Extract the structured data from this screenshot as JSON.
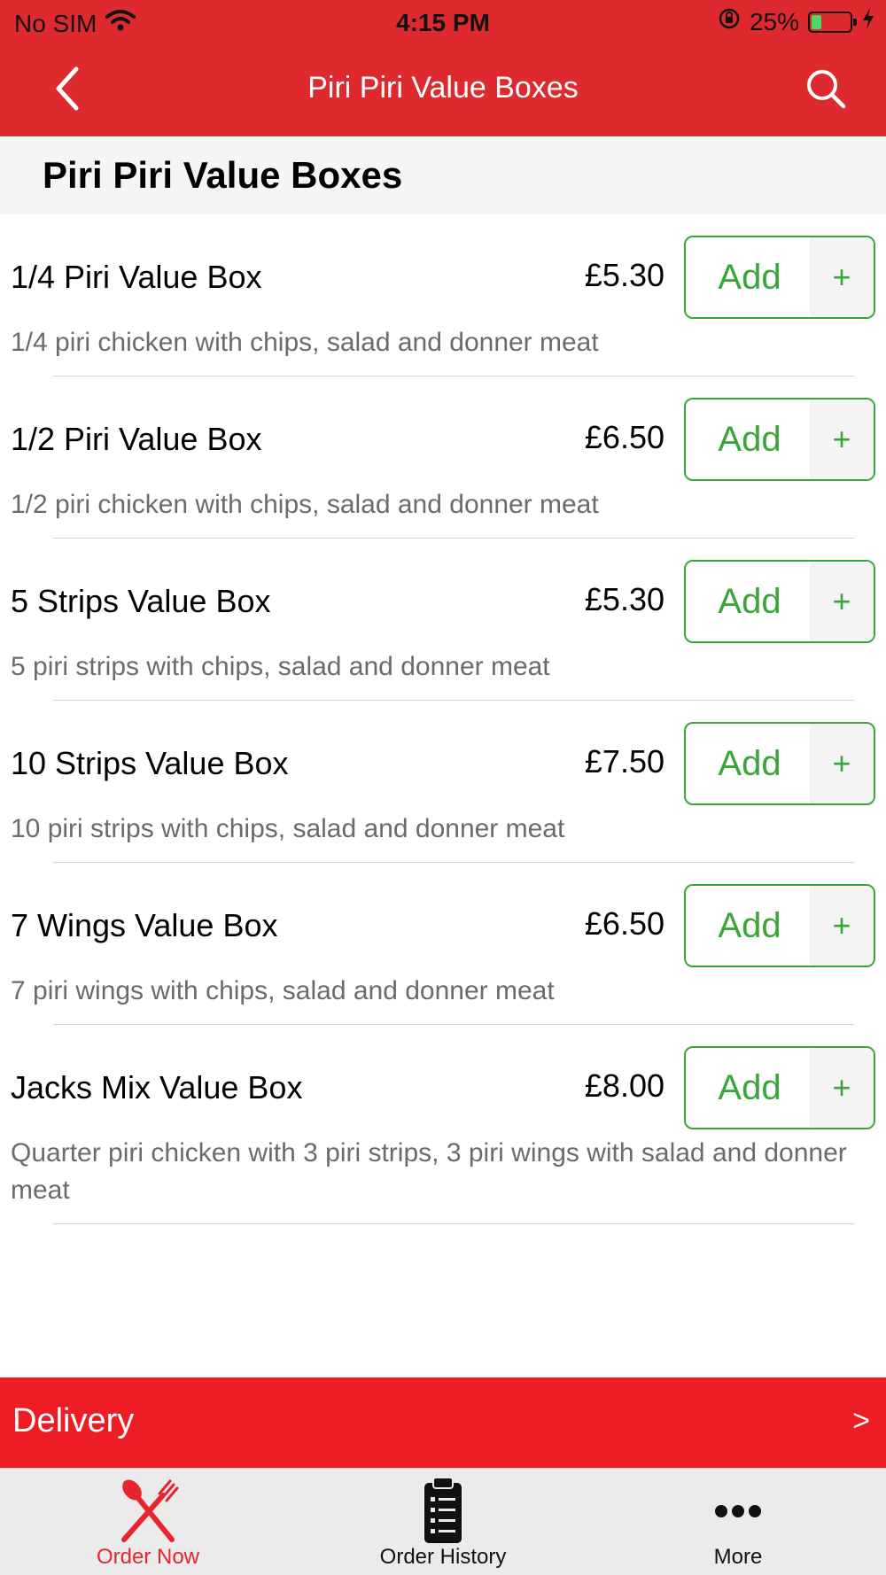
{
  "status_bar": {
    "carrier": "No SIM",
    "time": "4:15 PM",
    "battery_percent": "25%",
    "battery_level": 0.25,
    "icons": [
      "wifi-icon",
      "rotation-lock-icon",
      "battery-icon",
      "charging-bolt-icon"
    ]
  },
  "nav": {
    "title": "Piri Piri Value Boxes",
    "back_icon": "chevron-left-icon",
    "search_icon": "search-icon"
  },
  "section": {
    "title": "Piri Piri Value Boxes"
  },
  "items": [
    {
      "name": "1/4 Piri Value Box",
      "price": "£5.30",
      "description": "1/4 piri chicken with chips, salad and donner meat",
      "add_label": "Add",
      "add_plus": "+"
    },
    {
      "name": "1/2 Piri Value Box",
      "price": "£6.50",
      "description": "1/2 piri chicken with chips, salad and donner meat",
      "add_label": "Add",
      "add_plus": "+"
    },
    {
      "name": "5 Strips Value Box",
      "price": "£5.30",
      "description": "5 piri strips with chips, salad and donner meat",
      "add_label": "Add",
      "add_plus": "+"
    },
    {
      "name": "10 Strips Value Box",
      "price": "£7.50",
      "description": "10 piri strips with chips, salad and donner meat",
      "add_label": "Add",
      "add_plus": "+"
    },
    {
      "name": "7 Wings Value Box",
      "price": "£6.50",
      "description": "7 piri wings with chips, salad and donner meat",
      "add_label": "Add",
      "add_plus": "+"
    },
    {
      "name": "Jacks Mix Value Box",
      "price": "£8.00",
      "description": "Quarter piri chicken with 3 piri strips, 3 piri wings with salad and donner meat",
      "add_label": "Add",
      "add_plus": "+"
    }
  ],
  "delivery": {
    "label": "Delivery",
    "arrow": ">"
  },
  "tabs": [
    {
      "label": "Order Now",
      "icon": "fork-knife-icon",
      "active": true
    },
    {
      "label": "Order History",
      "icon": "clipboard-icon",
      "active": false
    },
    {
      "label": "More",
      "icon": "more-dots-icon",
      "active": false
    }
  ],
  "colors": {
    "brand_red": "#de2a2f",
    "delivery_red": "#ee1c25",
    "add_green": "#3aa63a",
    "tab_active": "#e8252c",
    "tab_inactive": "#111111"
  }
}
